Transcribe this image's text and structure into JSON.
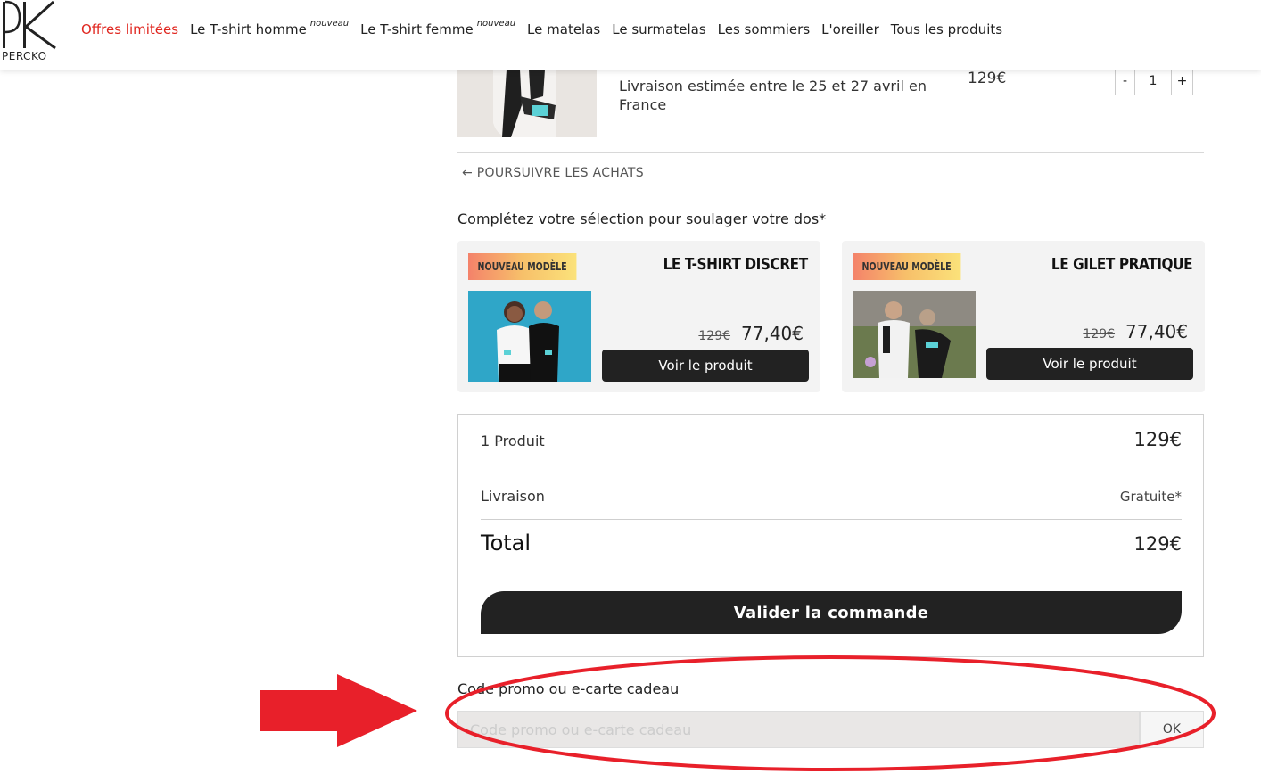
{
  "brand": {
    "name": "PERCKO"
  },
  "nav": {
    "items": [
      {
        "label": "Offres limitées",
        "tag": ""
      },
      {
        "label": "Le T-shirt homme",
        "tag": "nouveau"
      },
      {
        "label": "Le T-shirt femme",
        "tag": "nouveau"
      },
      {
        "label": "Le matelas",
        "tag": ""
      },
      {
        "label": "Le surmatelas",
        "tag": ""
      },
      {
        "label": "Les sommiers",
        "tag": ""
      },
      {
        "label": "L'oreiller",
        "tag": ""
      },
      {
        "label": "Tous les produits",
        "tag": ""
      }
    ],
    "active_color": "#e0261f"
  },
  "cart_item": {
    "delivery": "Livraison estimée entre le 25 et 27 avril en France",
    "price": "129€",
    "quantity": {
      "minus": "-",
      "value": "1",
      "plus": "+"
    }
  },
  "continue_label": "← POURSUIVRE LES ACHATS",
  "upsell": {
    "title": "Complétez votre sélection pour soulager votre dos*",
    "cards": [
      {
        "badge": "NOUVEAU MODÈLE",
        "title": "LE T-SHIRT DISCRET",
        "old_price": "129€",
        "price": "77,40€",
        "button": "Voir le produit"
      },
      {
        "badge": "NOUVEAU MODÈLE",
        "title": "LE GILET PRATIQUE",
        "old_price": "129€",
        "price": "77,40€",
        "button": "Voir le produit"
      }
    ]
  },
  "summary": {
    "products_label": "1 Produit",
    "products_value": "129€",
    "delivery_label": "Livraison",
    "delivery_value": "Gratuite*",
    "total_label": "Total",
    "total_value": "129€",
    "validate_button": "Valider la commande"
  },
  "promo": {
    "label": "Code promo ou e-carte cadeau",
    "placeholder": "Code promo ou e-carte cadeau",
    "value": "",
    "ok_button": "OK"
  },
  "annotation": {
    "color": "#e8202a"
  }
}
